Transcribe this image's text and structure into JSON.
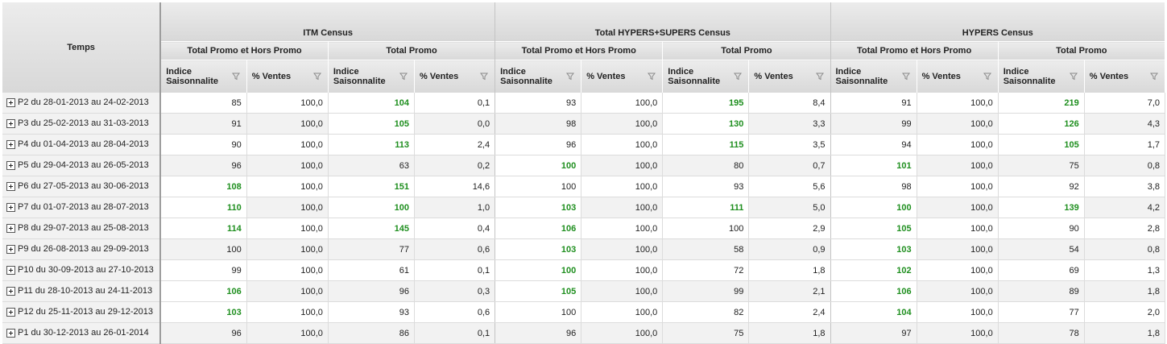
{
  "header": {
    "row_dimension": "Temps",
    "groups": [
      {
        "label": "ITM Census",
        "subgroups": [
          "Total Promo et Hors Promo",
          "Total Promo"
        ]
      },
      {
        "label": "Total HYPERS+SUPERS Census",
        "subgroups": [
          "Total Promo et Hors Promo",
          "Total Promo"
        ]
      },
      {
        "label": "HYPERS Census",
        "subgroups": [
          "Total Promo et Hors Promo",
          "Total Promo"
        ]
      }
    ],
    "measures": {
      "indice_line1": "Indice",
      "indice_line2": "Saisonnalite",
      "ventes": "% Ventes"
    },
    "filter_icon": "filter-icon"
  },
  "rows": [
    {
      "label": "P2 du 28-01-2013 au 24-02-2013",
      "values": [
        "85",
        "100,0",
        "104",
        "0,1",
        "93",
        "100,0",
        "195",
        "8,4",
        "91",
        "100,0",
        "219",
        "7,0"
      ],
      "highlight": [
        2,
        6,
        10
      ]
    },
    {
      "label": "P3 du 25-02-2013 au 31-03-2013",
      "values": [
        "91",
        "100,0",
        "105",
        "0,0",
        "98",
        "100,0",
        "130",
        "3,3",
        "99",
        "100,0",
        "126",
        "4,3"
      ],
      "highlight": [
        2,
        6,
        10
      ]
    },
    {
      "label": "P4 du 01-04-2013 au 28-04-2013",
      "values": [
        "90",
        "100,0",
        "113",
        "2,4",
        "96",
        "100,0",
        "115",
        "3,5",
        "94",
        "100,0",
        "105",
        "1,7"
      ],
      "highlight": [
        2,
        6,
        10
      ]
    },
    {
      "label": "P5 du 29-04-2013 au 26-05-2013",
      "values": [
        "96",
        "100,0",
        "63",
        "0,2",
        "100",
        "100,0",
        "80",
        "0,7",
        "101",
        "100,0",
        "75",
        "0,8"
      ],
      "highlight": [
        4,
        8
      ]
    },
    {
      "label": "P6 du 27-05-2013 au 30-06-2013",
      "values": [
        "108",
        "100,0",
        "151",
        "14,6",
        "100",
        "100,0",
        "93",
        "5,6",
        "98",
        "100,0",
        "92",
        "3,8"
      ],
      "highlight": [
        0,
        2
      ]
    },
    {
      "label": "P7 du 01-07-2013 au 28-07-2013",
      "values": [
        "110",
        "100,0",
        "100",
        "1,0",
        "103",
        "100,0",
        "111",
        "5,0",
        "100",
        "100,0",
        "139",
        "4,2"
      ],
      "highlight": [
        0,
        2,
        4,
        6,
        8,
        10
      ]
    },
    {
      "label": "P8 du 29-07-2013 au 25-08-2013",
      "values": [
        "114",
        "100,0",
        "145",
        "0,4",
        "106",
        "100,0",
        "100",
        "2,9",
        "105",
        "100,0",
        "90",
        "2,8"
      ],
      "highlight": [
        0,
        2,
        4,
        8
      ]
    },
    {
      "label": "P9 du 26-08-2013 au 29-09-2013",
      "values": [
        "100",
        "100,0",
        "77",
        "0,6",
        "103",
        "100,0",
        "58",
        "0,9",
        "103",
        "100,0",
        "54",
        "0,8"
      ],
      "highlight": [
        4,
        8
      ]
    },
    {
      "label": "P10 du 30-09-2013 au 27-10-2013",
      "values": [
        "99",
        "100,0",
        "61",
        "0,1",
        "100",
        "100,0",
        "72",
        "1,8",
        "102",
        "100,0",
        "69",
        "1,3"
      ],
      "highlight": [
        4,
        8
      ]
    },
    {
      "label": "P11 du 28-10-2013 au 24-11-2013",
      "values": [
        "106",
        "100,0",
        "96",
        "0,3",
        "105",
        "100,0",
        "99",
        "2,1",
        "106",
        "100,0",
        "89",
        "1,8"
      ],
      "highlight": [
        0,
        4,
        8
      ]
    },
    {
      "label": "P12 du 25-11-2013 au 29-12-2013",
      "values": [
        "103",
        "100,0",
        "93",
        "0,6",
        "100",
        "100,0",
        "82",
        "2,4",
        "104",
        "100,0",
        "77",
        "2,0"
      ],
      "highlight": [
        0,
        8
      ]
    },
    {
      "label": "P1 du 30-12-2013 au 26-01-2014",
      "values": [
        "96",
        "100,0",
        "86",
        "0,1",
        "96",
        "100,0",
        "75",
        "1,8",
        "97",
        "100,0",
        "78",
        "1,8"
      ],
      "highlight": []
    }
  ],
  "colors": {
    "highlight_text": "#1f8f1f",
    "header_bg": "#dcdcdc",
    "row_alt_bg": "#f2f2f2"
  }
}
